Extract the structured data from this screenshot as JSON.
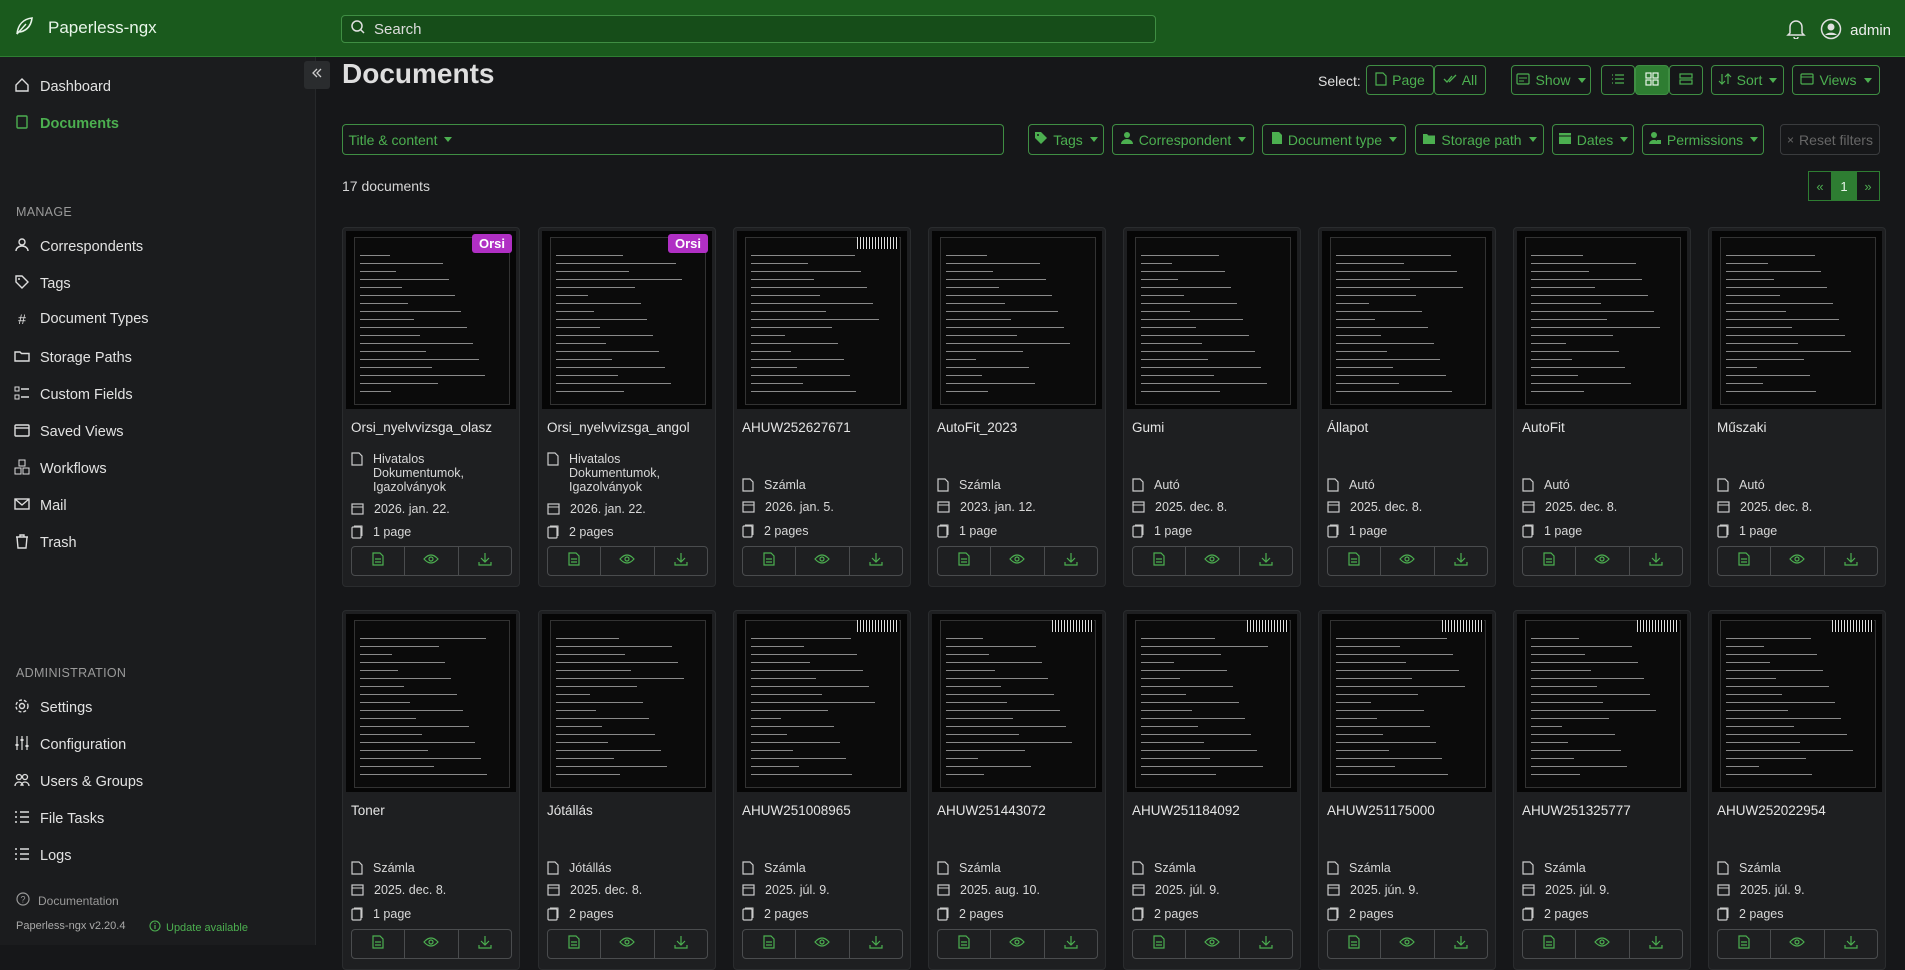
{
  "app": {
    "name": "Paperless-ngx",
    "version": "Paperless-ngx v2.20.4",
    "update": "Update available",
    "documentation": "Documentation"
  },
  "search": {
    "placeholder": "Search"
  },
  "user": {
    "name": "admin"
  },
  "sidebar": {
    "main": [
      {
        "label": "Dashboard"
      },
      {
        "label": "Documents"
      }
    ],
    "manage_heading": "MANAGE",
    "manage": [
      {
        "label": "Correspondents"
      },
      {
        "label": "Tags"
      },
      {
        "label": "Document Types"
      },
      {
        "label": "Storage Paths"
      },
      {
        "label": "Custom Fields"
      },
      {
        "label": "Saved Views"
      },
      {
        "label": "Workflows"
      },
      {
        "label": "Mail"
      },
      {
        "label": "Trash"
      }
    ],
    "admin_heading": "ADMINISTRATION",
    "admin": [
      {
        "label": "Settings"
      },
      {
        "label": "Configuration"
      },
      {
        "label": "Users & Groups"
      },
      {
        "label": "File Tasks"
      },
      {
        "label": "Logs"
      }
    ]
  },
  "page": {
    "title": "Documents",
    "select_label": "Select:",
    "select_page": "Page",
    "select_all": "All",
    "show": "Show",
    "sort": "Sort",
    "views": "Views",
    "count": "17 documents",
    "current_page": "1"
  },
  "filters": {
    "title_content": "Title & content",
    "tags": "Tags",
    "correspondent": "Correspondent",
    "document_type": "Document type",
    "storage_path": "Storage path",
    "dates": "Dates",
    "permissions": "Permissions",
    "reset": "Reset filters"
  },
  "documents": [
    {
      "title": "Orsi_nyelvvizsga_olasz",
      "badge": "Orsi",
      "type": "Hivatalos Dokumentumok, Igazolványok",
      "date": "2026. jan. 22.",
      "pages": "1 page"
    },
    {
      "title": "Orsi_nyelvvizsga_angol",
      "badge": "Orsi",
      "type": "Hivatalos Dokumentumok, Igazolványok",
      "date": "2026. jan. 22.",
      "pages": "2 pages"
    },
    {
      "title": "AHUW252627671",
      "type": "Számla",
      "date": "2026. jan. 5.",
      "pages": "2 pages"
    },
    {
      "title": "AutoFit_2023",
      "type": "Számla",
      "date": "2023. jan. 12.",
      "pages": "1 page"
    },
    {
      "title": "Gumi",
      "type": "Autó",
      "date": "2025. dec. 8.",
      "pages": "1 page"
    },
    {
      "title": "Állapot",
      "type": "Autó",
      "date": "2025. dec. 8.",
      "pages": "1 page"
    },
    {
      "title": "AutoFit",
      "type": "Autó",
      "date": "2025. dec. 8.",
      "pages": "1 page"
    },
    {
      "title": "Műszaki",
      "type": "Autó",
      "date": "2025. dec. 8.",
      "pages": "1 page"
    },
    {
      "title": "Toner",
      "type": "Számla",
      "date": "2025. dec. 8.",
      "pages": "1 page"
    },
    {
      "title": "Jótállás",
      "type": "Jótállás",
      "date": "2025. dec. 8.",
      "pages": "2 pages"
    },
    {
      "title": "AHUW251008965",
      "type": "Számla",
      "date": "2025. júl. 9.",
      "pages": "2 pages"
    },
    {
      "title": "AHUW251443072",
      "type": "Számla",
      "date": "2025. aug. 10.",
      "pages": "2 pages"
    },
    {
      "title": "AHUW251184092",
      "type": "Számla",
      "date": "2025. júl. 9.",
      "pages": "2 pages"
    },
    {
      "title": "AHUW251175000",
      "type": "Számla",
      "date": "2025. jún. 9.",
      "pages": "2 pages"
    },
    {
      "title": "AHUW251325777",
      "type": "Számla",
      "date": "2025. júl. 9.",
      "pages": "2 pages"
    },
    {
      "title": "AHUW252022954",
      "type": "Számla",
      "date": "2025. júl. 9.",
      "pages": "2 pages"
    }
  ],
  "colors": {
    "accent": "#4caf50",
    "topbar": "#1a5a1d",
    "badge": "#b02fc4",
    "background": "#161719"
  }
}
